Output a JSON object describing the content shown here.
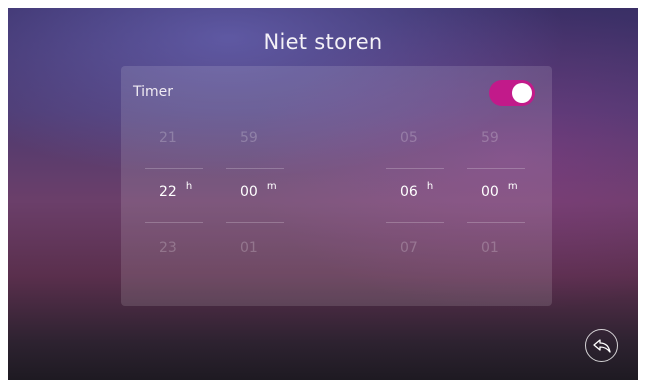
{
  "header": {
    "title": "Niet storen"
  },
  "timer": {
    "label": "Timer",
    "enabled": true,
    "accent_color": "#c21a8a"
  },
  "pickers": [
    {
      "name": "start-hours",
      "prev": "21",
      "value": "22",
      "next": "23",
      "unit": "h"
    },
    {
      "name": "start-minutes",
      "prev": "59",
      "value": "00",
      "next": "01",
      "unit": "m"
    },
    {
      "name": "end-hours",
      "prev": "05",
      "value": "06",
      "next": "07",
      "unit": "h"
    },
    {
      "name": "end-minutes",
      "prev": "59",
      "value": "00",
      "next": "01",
      "unit": "m"
    }
  ],
  "footer": {
    "back_icon": "back-arrow-icon"
  }
}
